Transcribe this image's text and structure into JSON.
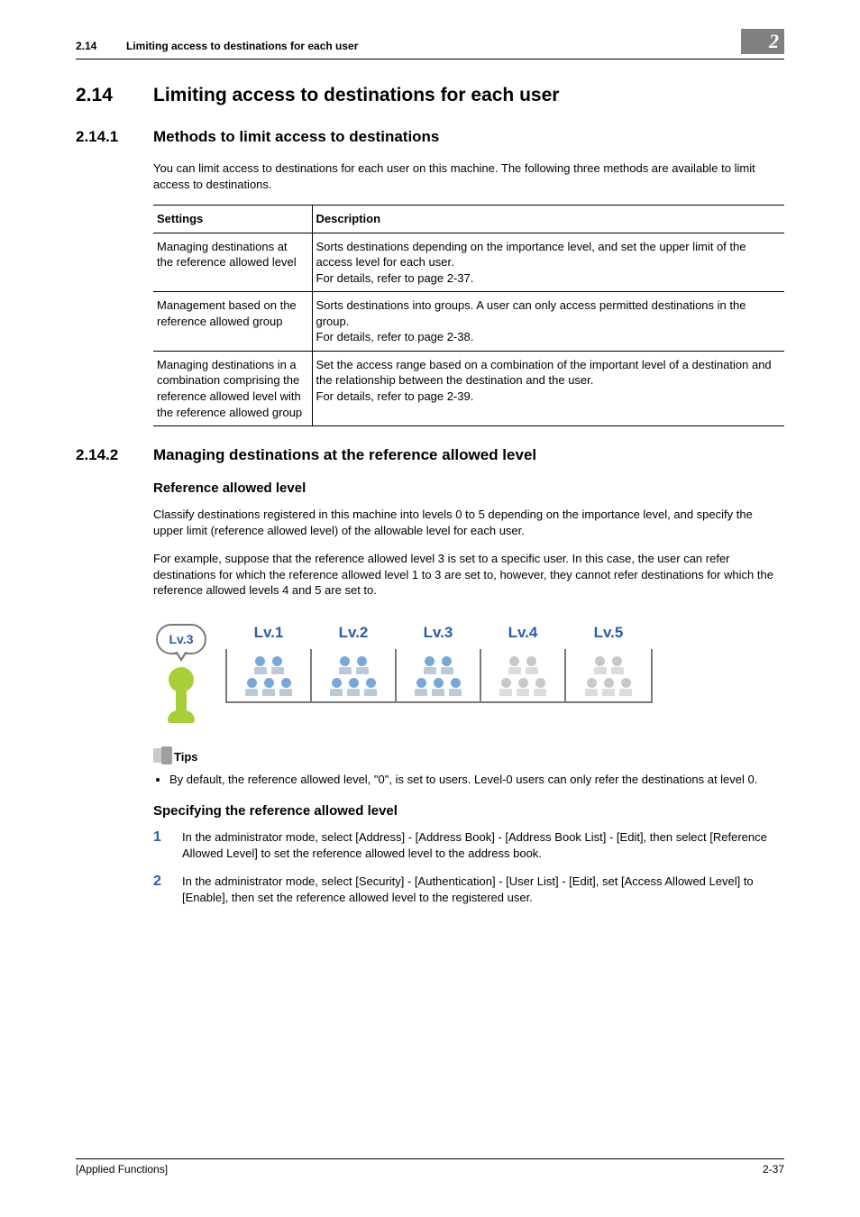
{
  "chapter_badge": "2",
  "running_head": {
    "num": "2.14",
    "title": "Limiting access to destinations for each user"
  },
  "h1": {
    "num": "2.14",
    "title": "Limiting access to destinations for each user"
  },
  "s1": {
    "num": "2.14.1",
    "title": "Methods to limit access to destinations",
    "intro": "You can limit access to destinations for each user on this machine. The following three methods are available to limit access to destinations.",
    "table": {
      "head": {
        "a": "Settings",
        "b": "Description"
      },
      "rows": [
        {
          "a": "Managing destinations at the reference allowed level",
          "b": "Sorts destinations depending on the importance level, and set the upper limit of the access level for each user.\nFor details, refer to page 2-37."
        },
        {
          "a": "Management based on the reference allowed group",
          "b": "Sorts destinations into groups. A user can only access permitted destinations in the group.\nFor details, refer to page 2-38."
        },
        {
          "a": "Managing destinations in a combination comprising the reference allowed level with the reference allowed group",
          "b": "Set the access range based on a combination of the important level of a destination and the relationship between the destination and the user.\nFor details, refer to page 2-39."
        }
      ]
    }
  },
  "s2": {
    "num": "2.14.2",
    "title": "Managing destinations at the reference allowed level",
    "h3a": "Reference allowed level",
    "p1": "Classify destinations registered in this machine into levels 0 to 5 depending on the importance level, and specify the upper limit (reference allowed level) of the allowable level for each user.",
    "p2": "For example, suppose that the reference allowed level 3 is set to a specific user. In this case, the user can refer destinations for which the reference allowed level 1 to 3 are set to, however, they cannot refer destinations for which the reference allowed levels 4 and 5 are set to.",
    "figure": {
      "bubble": "Lv.3",
      "levels": [
        "Lv.1",
        "Lv.2",
        "Lv.3",
        "Lv.4",
        "Lv.5"
      ],
      "active": [
        true,
        true,
        true,
        false,
        false
      ]
    },
    "tips_label": "Tips",
    "tips": [
      "By default, the reference allowed level, \"0\", is set to users. Level-0 users can only refer the destinations at level 0."
    ],
    "h3b": "Specifying the reference allowed level",
    "steps": [
      "In the administrator mode, select [Address] - [Address Book] - [Address Book List] - [Edit], then select [Reference Allowed Level] to set the reference allowed level to the address book.",
      "In the administrator mode, select [Security] - [Authentication] - [User List] - [Edit], set [Access Allowed Level] to [Enable], then set the reference allowed level to the registered user."
    ]
  },
  "footer": {
    "left": "[Applied Functions]",
    "right": "2-37"
  }
}
